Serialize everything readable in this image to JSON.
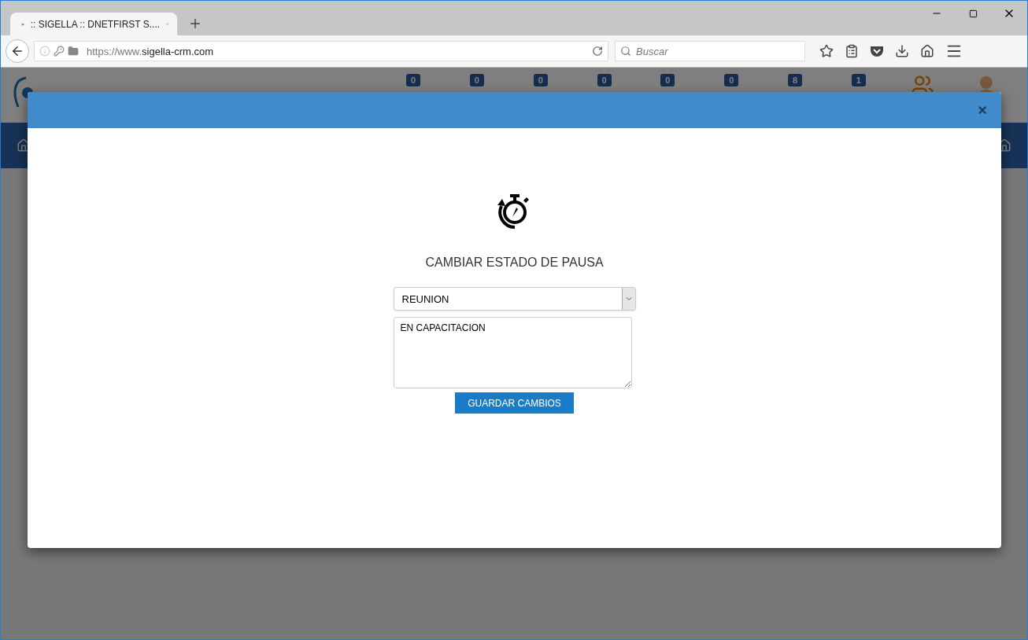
{
  "browser": {
    "tab_title": ":: SIGELLA :: DNETFIRST S....",
    "url_prefix": "https://www.",
    "url_domain": "sigella-crm.com",
    "search_placeholder": "Buscar"
  },
  "app": {
    "counters": [
      "0",
      "0",
      "0",
      "0",
      "0",
      "0",
      "8",
      "1"
    ]
  },
  "modal": {
    "close": "×",
    "title": "CAMBIAR ESTADO DE PAUSA",
    "select_value": "REUNION",
    "textarea_value": "EN CAPACITACION",
    "button": "GUARDAR CAMBIOS"
  }
}
